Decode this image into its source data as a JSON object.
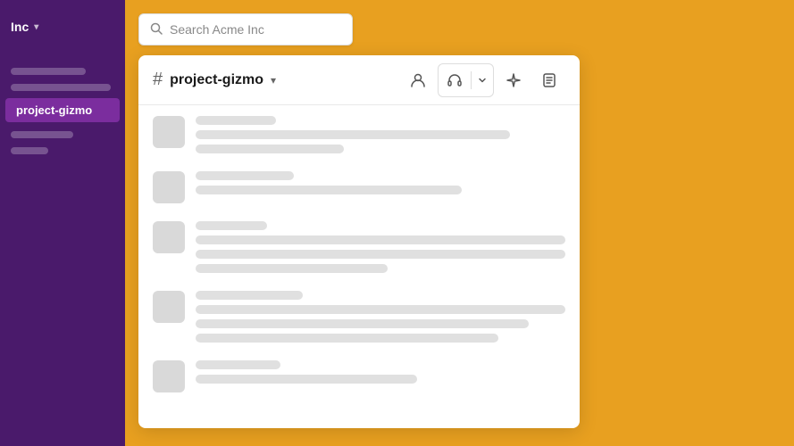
{
  "workspace": {
    "name": "Inc",
    "chevron": "▾"
  },
  "search": {
    "placeholder": "Search Acme Inc"
  },
  "sidebar": {
    "items": [
      {
        "label": "",
        "active": false,
        "placeholder_width": "60%"
      },
      {
        "label": "",
        "active": false,
        "placeholder_width": "80%"
      },
      {
        "label": "project-gizmo",
        "active": true
      },
      {
        "label": "",
        "active": false,
        "placeholder_width": "50%"
      },
      {
        "label": "",
        "active": false,
        "placeholder_width": "70%"
      }
    ]
  },
  "channel": {
    "hash": "#",
    "name": "project-gizmo",
    "chevron": "▾"
  },
  "header_buttons": {
    "person_icon": "👤",
    "headphone_icon": "🎧",
    "dropdown_icon": "▾",
    "sparkle_icon": "✦",
    "sticky_icon": "📋"
  },
  "messages": [
    {
      "lines": [
        {
          "width": "60%",
          "type": "name"
        },
        {
          "width": "85%",
          "type": "body"
        },
        {
          "width": "40%",
          "type": "body"
        }
      ]
    },
    {
      "lines": [
        {
          "width": "70%",
          "type": "name"
        },
        {
          "width": "75%",
          "type": "body"
        }
      ]
    },
    {
      "lines": [
        {
          "width": "50%",
          "type": "name"
        },
        {
          "width": "100%",
          "type": "body"
        },
        {
          "width": "100%",
          "type": "body"
        },
        {
          "width": "55%",
          "type": "body"
        }
      ]
    },
    {
      "lines": [
        {
          "width": "55%",
          "type": "name"
        },
        {
          "width": "100%",
          "type": "body"
        },
        {
          "width": "90%",
          "type": "body"
        },
        {
          "width": "85%",
          "type": "body"
        }
      ]
    },
    {
      "lines": [
        {
          "width": "50%",
          "type": "name"
        },
        {
          "width": "65%",
          "type": "body"
        }
      ]
    }
  ]
}
